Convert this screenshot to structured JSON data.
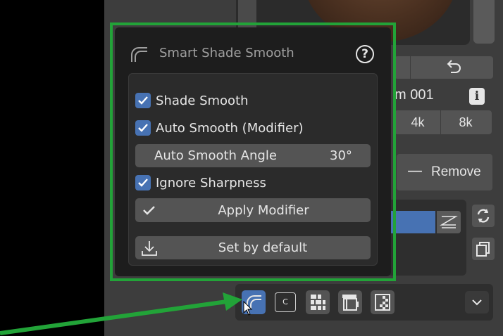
{
  "popup": {
    "title": "Smart Shade Smooth",
    "help_icon": "?",
    "options": [
      {
        "label": "Shade Smooth",
        "checked": true
      },
      {
        "label": "Auto Smooth (Modifier)",
        "checked": true
      },
      {
        "label": "Ignore Sharpness",
        "checked": true
      }
    ],
    "angle": {
      "label": "Auto Smooth Angle",
      "value": "30°"
    },
    "apply_button": "Apply Modifier",
    "set_default_button": "Set by default"
  },
  "background_panel": {
    "name_fragment": "m 001",
    "info_icon": "i",
    "resolutions": [
      "4k",
      "8k"
    ],
    "remove_button": "Remove",
    "remove_icon": "—"
  },
  "toolbar": {
    "c_button": "C"
  },
  "colors": {
    "accent_blue": "#4772b3",
    "highlight_green": "#22a338",
    "popup_bg": "#1d1d1d",
    "button_bg": "#545454"
  },
  "icons": [
    "smooth-curve-icon",
    "help-icon",
    "checkbox-check-icon",
    "checkmark-icon",
    "download-icon",
    "undo-icon",
    "info-icon",
    "refresh-icon",
    "copy-icon",
    "grid-icon",
    "film-icon",
    "checker-icon",
    "chevron-down-icon",
    "cursor-icon",
    "arrow-annotation"
  ]
}
